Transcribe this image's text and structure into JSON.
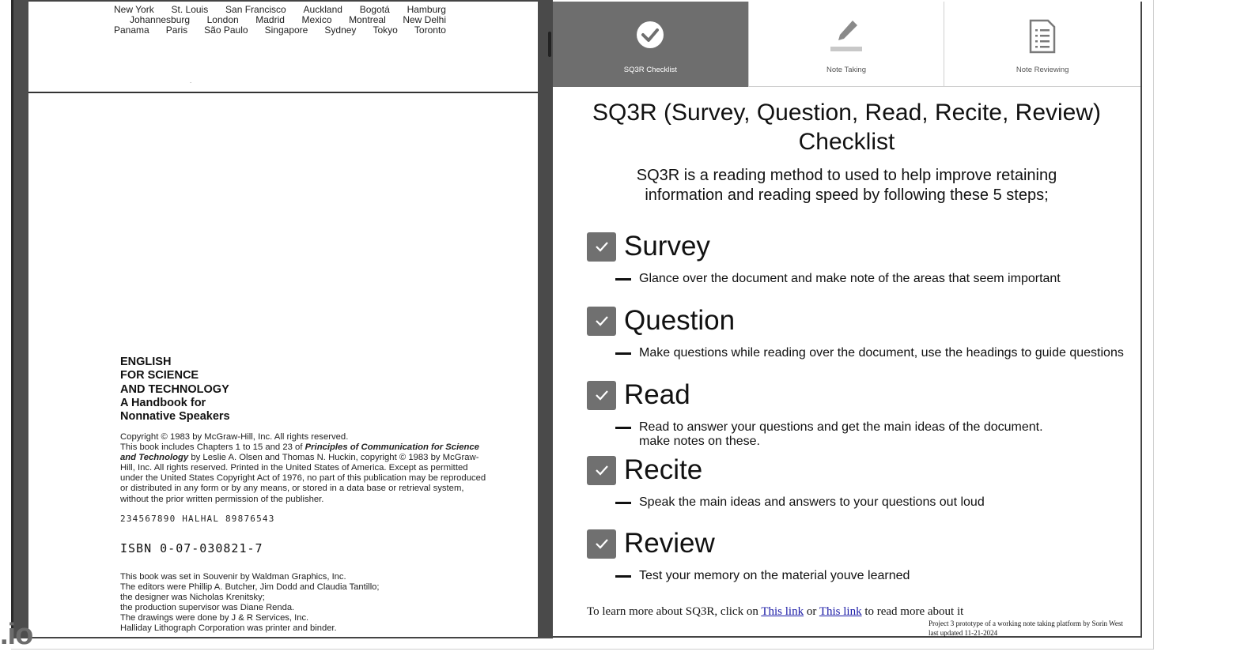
{
  "document": {
    "cities_rows": [
      [
        "New York",
        "St. Louis",
        "San Francisco",
        "Auckland",
        "Bogotá",
        "Hamburg"
      ],
      [
        "Johannesburg",
        "London",
        "Madrid",
        "Mexico",
        "Montreal",
        "New Delhi"
      ],
      [
        "Panama",
        "Paris",
        "São Paulo",
        "Singapore",
        "Sydney",
        "Tokyo",
        "Toronto"
      ]
    ],
    "page_mark": ".",
    "title_lines": [
      "ENGLISH",
      "FOR SCIENCE",
      "AND TECHNOLOGY",
      "A Handbook for",
      "Nonnative Speakers"
    ],
    "copyright_1": "Copyright © 1983 by McGraw-Hill, Inc. All rights reserved.",
    "copyright_2": "This book includes Chapters 1 to 15 and 23 of ",
    "copyright_italic": "Principles of Communication for Science and Technology",
    "copyright_3": " by Leslie A. Olsen and Thomas N. Huckin, copyright © 1983 by McGraw-Hill, Inc. All rights reserved. Printed in the United States of America. Except as permitted under the United States Copyright Act of 1976, no part of this publication may be reproduced or distributed in any form or by any means, or stored in a data base or retrieval system, without the prior written permission of the publisher.",
    "print_line": "234567890 HALHAL 89876543",
    "isbn": "ISBN 0-07-030821-7",
    "colophon_lines": [
      "This book was set in Souvenir by Waldman Graphics, Inc.",
      "The editors were Phillip A. Butcher, Jim Dodd and Claudia Tantillo;",
      "the designer was Nicholas Krenitsky;",
      "the production supervisor was Diane Renda.",
      "The drawings were done by J & R Services, Inc.",
      "Halliday Lithograph Corporation was printer and binder."
    ]
  },
  "watermark": ".io",
  "tabs": [
    {
      "label": "SQ3R Checklist",
      "icon": "check-circle-icon",
      "active": true
    },
    {
      "label": "Note Taking",
      "icon": "pencil-icon",
      "active": false
    },
    {
      "label": "Note Reviewing",
      "icon": "document-list-icon",
      "active": false
    }
  ],
  "checklist": {
    "heading": "SQ3R (Survey, Question, Read, Recite, Review) Checklist",
    "intro": "SQ3R is a reading method to used to help improve retaining information and reading speed by following these 5 steps;",
    "steps": [
      {
        "title": "Survey",
        "desc": "Glance over the document and make note of the areas that seem important",
        "checked": true
      },
      {
        "title": "Question",
        "desc": "Make questions while reading over the document, use the headings to guide questions",
        "checked": true
      },
      {
        "title": "Read",
        "desc": "Read to answer your questions and get the main ideas of the document.",
        "desc2": "make notes on these.",
        "checked": true
      },
      {
        "title": "Recite",
        "desc": "Speak the main ideas and answers to your questions out loud",
        "checked": true
      },
      {
        "title": "Review",
        "desc": "Test your memory on the material youve learned",
        "checked": true
      }
    ],
    "footer_prefix": "To learn more about SQ3R, click on ",
    "link1": "This link",
    "footer_or": " or ",
    "link2": "This link",
    "footer_suffix": " to read more about it",
    "credit_line1": "Project 3 prototype of a working note taking platform by Sorin West",
    "credit_line2": "last updated 11-21-2024"
  },
  "colors": {
    "tab_active": "#6e6e6e",
    "checkbox": "#707070",
    "link": "#1a1aa6"
  }
}
